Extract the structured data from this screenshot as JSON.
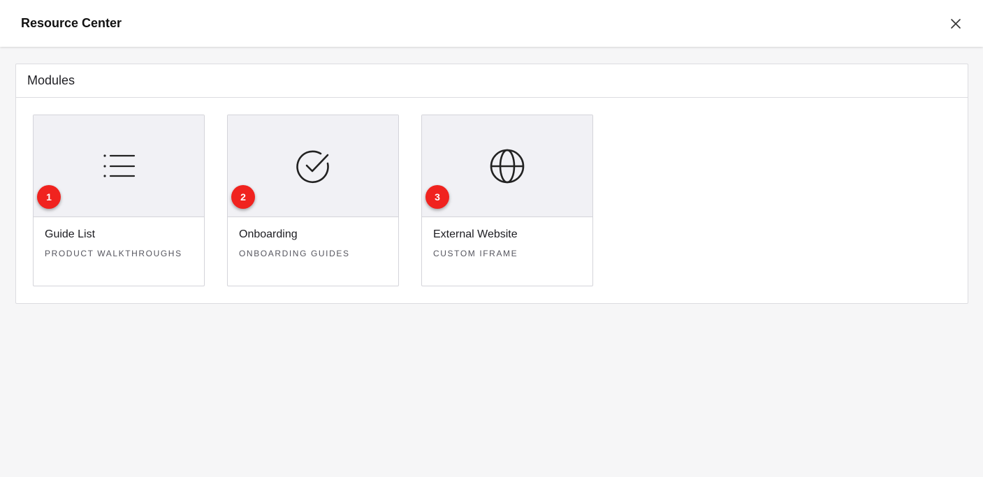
{
  "header": {
    "title": "Resource Center",
    "close_icon": "close-icon"
  },
  "panel": {
    "title": "Modules",
    "cards": [
      {
        "badge": "1",
        "title": "Guide List",
        "subtitle": "PRODUCT WALKTHROUGHS",
        "icon": "list-icon"
      },
      {
        "badge": "2",
        "title": "Onboarding",
        "subtitle": "ONBOARDING GUIDES",
        "icon": "check-circle-icon"
      },
      {
        "badge": "3",
        "title": "External Website",
        "subtitle": "CUSTOM IFRAME",
        "icon": "globe-icon"
      }
    ]
  },
  "colors": {
    "badge": "#f0231f",
    "card_media_bg": "#f1f1f5",
    "page_bg": "#f6f6f7"
  }
}
